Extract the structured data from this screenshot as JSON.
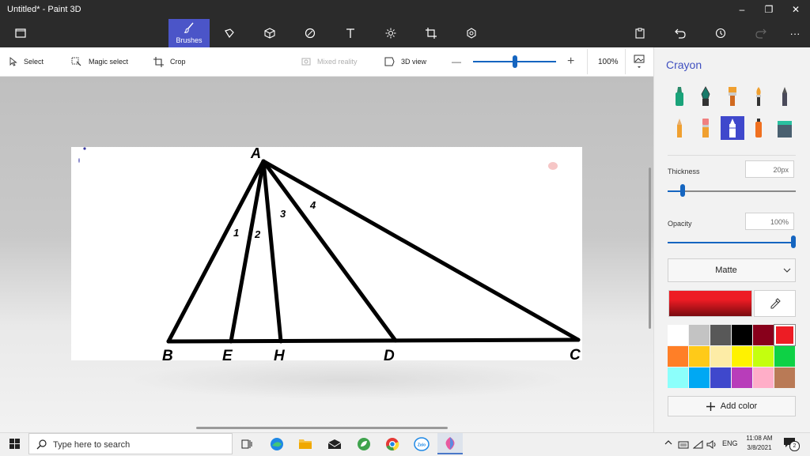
{
  "window": {
    "title": "Untitled* - Paint 3D",
    "minimize_glyph": "–",
    "maximize_glyph": "❐",
    "close_glyph": "✕"
  },
  "toolbar": {
    "brushes_label": "Brushes",
    "more_glyph": "···"
  },
  "subtoolbar": {
    "select_label": "Select",
    "magic_select_label": "Magic select",
    "crop_label": "Crop",
    "mixed_reality_label": "Mixed reality",
    "view_3d_label": "3D view",
    "zoom_minus": "—",
    "zoom_plus": "+",
    "zoom_value": "100%",
    "zoom_fraction": 0.5
  },
  "drawing": {
    "point_labels": [
      "A",
      "B",
      "E",
      "H",
      "D",
      "C"
    ],
    "angle_labels": [
      "1",
      "2",
      "3",
      "4"
    ]
  },
  "panel": {
    "title": "Crayon",
    "thickness_label": "Thickness",
    "thickness_value": "20px",
    "thickness_fraction": 0.12,
    "opacity_label": "Opacity",
    "opacity_value": "100%",
    "opacity_fraction": 1.0,
    "finish_value": "Matte",
    "add_color_label": "Add color",
    "selected_color": "#ed1c24",
    "palette": [
      "#ffffff",
      "#c3c3c3",
      "#585858",
      "#000000",
      "#88001b",
      "#ed1c24",
      "#ff7f27",
      "#ffca18",
      "#fdeca6",
      "#fff200",
      "#c4ff0e",
      "#0ed145",
      "#8cfffb",
      "#00a8f3",
      "#3f48cc",
      "#b83dba",
      "#ffaec8",
      "#b97a56"
    ]
  },
  "taskbar": {
    "search_placeholder": "Type here to search",
    "language": "ENG",
    "time": "11:08 AM",
    "date": "3/8/2021",
    "notification_count": "2"
  }
}
